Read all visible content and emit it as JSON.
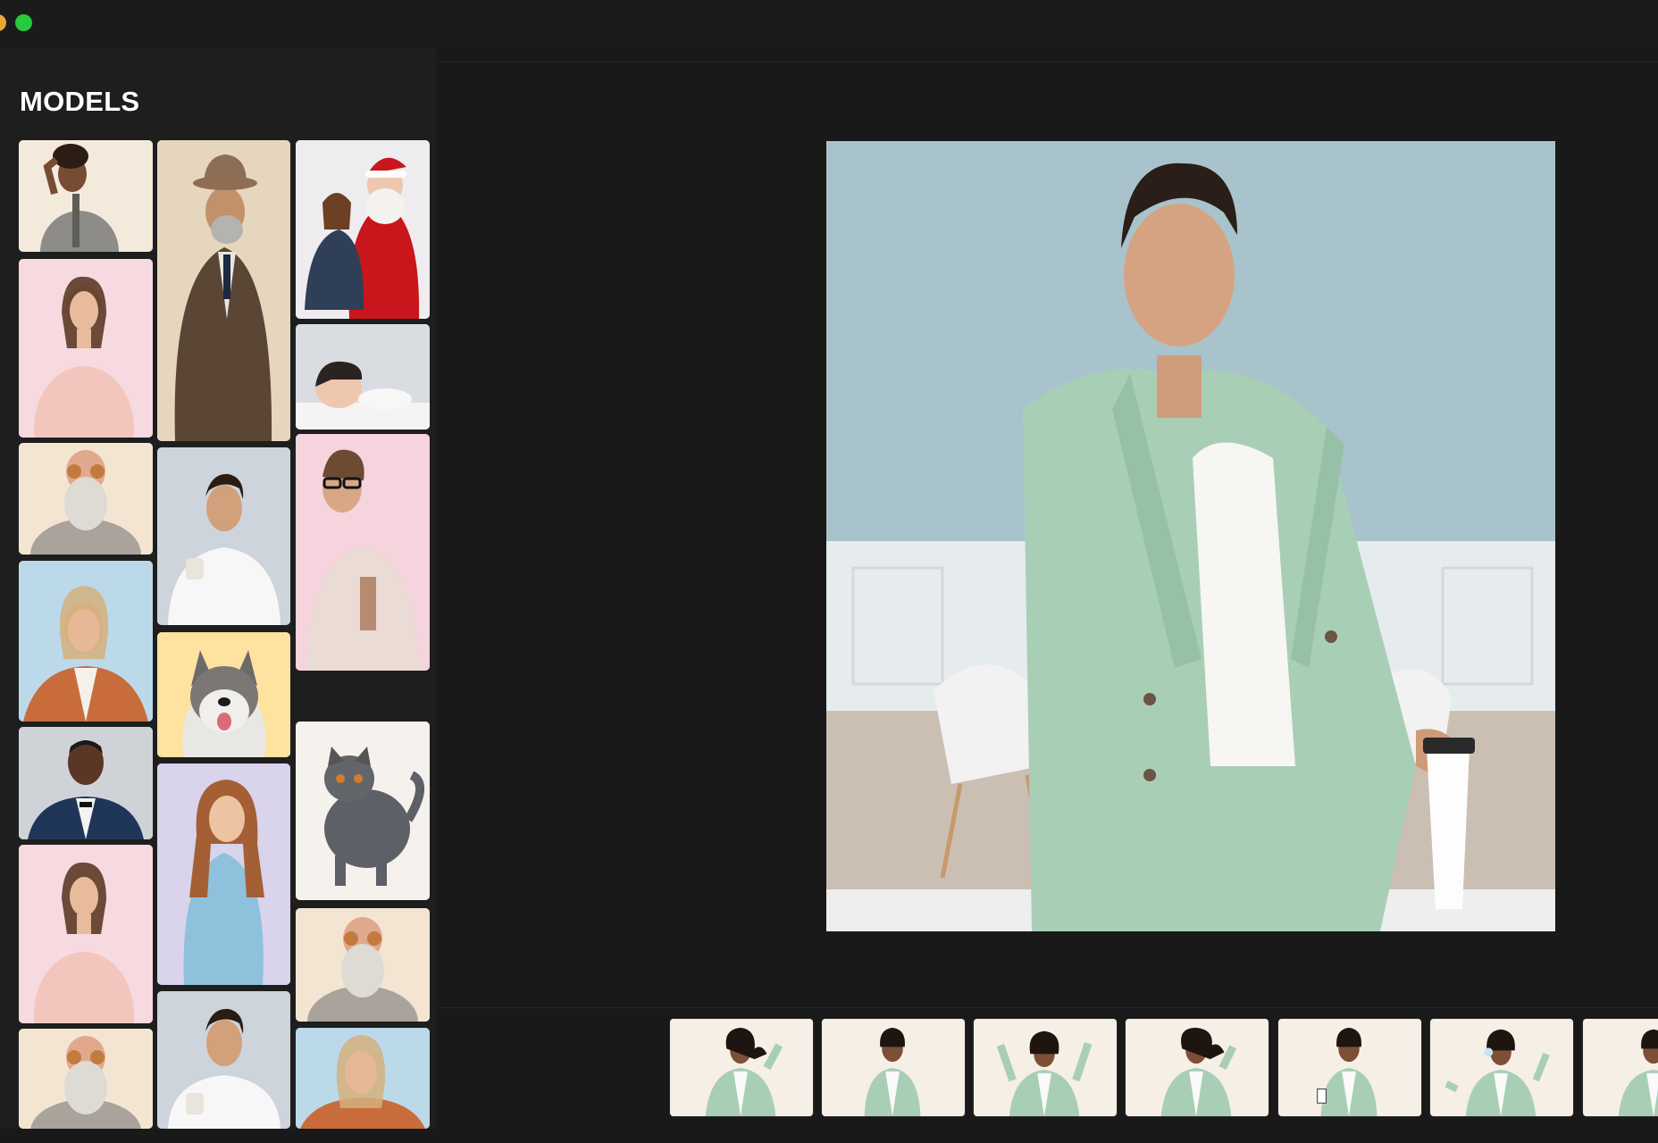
{
  "window": {
    "controls": [
      "minimize",
      "zoom"
    ]
  },
  "sidebar": {
    "title": "MODELS",
    "models": [
      {
        "name": "woman-ok-gesture",
        "bg": "#f4eadb"
      },
      {
        "name": "man-fedora-suit",
        "bg": "#e6d6bd"
      },
      {
        "name": "santa-with-girl",
        "bg": "#eeecef"
      },
      {
        "name": "woman-pink-blouse",
        "bg": "#f7d9e0"
      },
      {
        "name": "sleeping-child",
        "bg": "#d9dde2"
      },
      {
        "name": "bearded-man-cookies",
        "bg": "#f4e5d2"
      },
      {
        "name": "man-white-tshirt-cup",
        "bg": "#ced4dc"
      },
      {
        "name": "man-glasses-tattoo",
        "bg": "#f5d4de"
      },
      {
        "name": "woman-orange-blazer",
        "bg": "#bcd9ea"
      },
      {
        "name": "husky-dog",
        "bg": "#fde2a0"
      },
      {
        "name": "man-tuxedo",
        "bg": "#cfd3d8"
      },
      {
        "name": "grey-cat",
        "bg": "#f5f1ec"
      },
      {
        "name": "girl-denim-dress",
        "bg": "#d9d3ec"
      },
      {
        "name": "woman-pink-blouse-2",
        "bg": "#f7d9e0"
      },
      {
        "name": "bearded-man-cookies-2",
        "bg": "#f4e5d2"
      },
      {
        "name": "bearded-man-cookies-3",
        "bg": "#f4e5d2"
      },
      {
        "name": "man-white-tshirt-cup-2",
        "bg": "#ced4dc"
      },
      {
        "name": "woman-orange-blazer-2",
        "bg": "#bcd9ea"
      }
    ]
  },
  "preview": {
    "subject": "woman-mint-suit-coffee",
    "colors": {
      "wall": "#a9c3cc",
      "suit": "#a8cfb5",
      "floor": "#cbbfb4"
    }
  },
  "variations": [
    {
      "name": "pose-hair-flip"
    },
    {
      "name": "pose-standing"
    },
    {
      "name": "pose-arms-up"
    },
    {
      "name": "pose-hair-flip-2"
    },
    {
      "name": "pose-coffee"
    },
    {
      "name": "pose-headphones"
    },
    {
      "name": "pose-partial"
    }
  ]
}
